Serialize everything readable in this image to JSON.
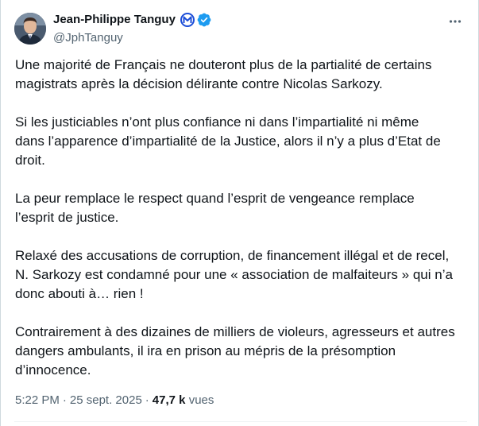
{
  "author": {
    "display_name": "Jean-Philippe Tanguy",
    "handle": "@JphTanguy",
    "affiliation_badge_icon": "party-logo-icon",
    "verified_icon": "verified-badge-icon",
    "verified_color": "#1d9bf0"
  },
  "tweet": {
    "paragraphs": [
      "Une majorité de Français ne douteront plus de la partialité de certains\nmagistrats après la décision délirante contre Nicolas Sarkozy.",
      "Si les justiciables n’ont plus confiance ni dans l’impartialité ni même\ndans l’apparence d’impartialité de la Justice, alors il n’y a plus d’Etat de\ndroit.",
      "La peur remplace le respect quand l’esprit de vengeance remplace\nl’esprit de justice.",
      "Relaxé des accusations de corruption, de financement illégal et de recel,\nN. Sarkozy est condamné pour une « association de malfaiteurs » qui n’a\ndonc abouti à… rien !",
      "Contrairement à des dizaines de milliers de violeurs, agresseurs et autres\ndangers ambulants, il ira en prison au mépris de la présomption\nd’innocence."
    ]
  },
  "meta": {
    "time": "5:22 PM",
    "separator": "·",
    "date": "25 sept. 2025",
    "views_count": "47,7 k",
    "views_label": "vues"
  },
  "more_menu_icon": "more-horizontal-icon",
  "colors": {
    "text": "#0f1419",
    "secondary": "#536471",
    "border": "#cfd9de"
  }
}
